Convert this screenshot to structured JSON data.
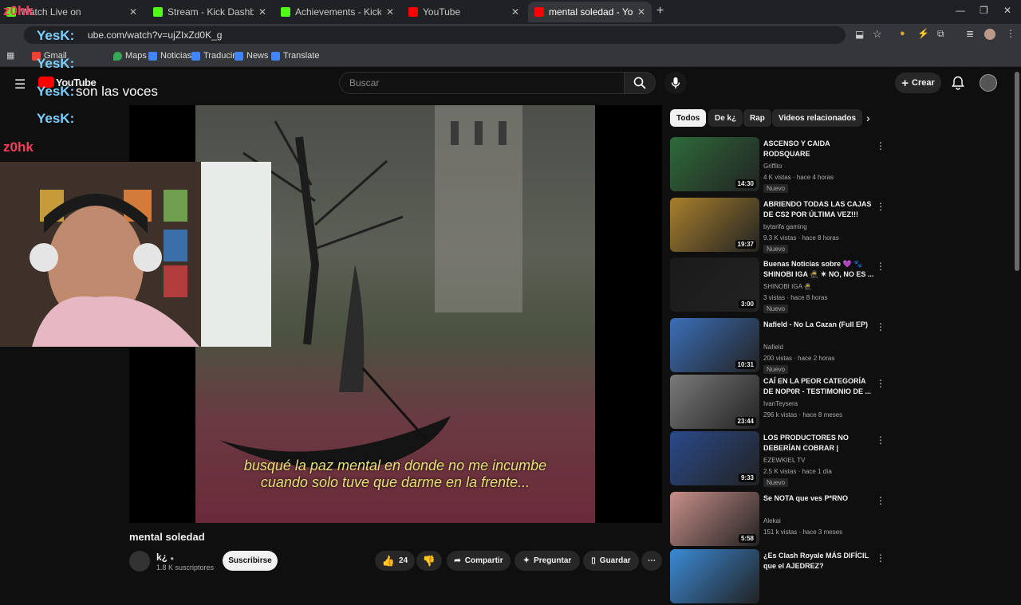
{
  "browser": {
    "tabs": [
      {
        "label": "Watch Live on",
        "icon_color": "#53fc18",
        "active": false
      },
      {
        "label": "Stream - Kick Dashboard",
        "icon_color": "#53fc18",
        "active": false
      },
      {
        "label": "Achievements - Kick Dashboard",
        "icon_color": "#53fc18",
        "active": false
      },
      {
        "label": "YouTube",
        "icon_color": "#ff0000",
        "active": false
      },
      {
        "label": "mental soledad - YouTube",
        "icon_color": "#ff0000",
        "active": true
      }
    ],
    "url": "ube.com/watch?v=ujZIxZd0K_g",
    "bookmarks": [
      "Gmail",
      "Maps",
      "Noticias",
      "Traducir",
      "News",
      "Translate"
    ]
  },
  "stream_overlay": {
    "chat": [
      {
        "user": "z0hk",
        "text": ""
      },
      {
        "user": "YesK:",
        "text": ""
      },
      {
        "user": "YesK:",
        "text": ""
      },
      {
        "user": "YesK:",
        "text": "son las voces"
      },
      {
        "user": "YesK:",
        "text": ""
      },
      {
        "user": "z0hk",
        "text": ""
      }
    ]
  },
  "youtube": {
    "logo": "YouTube",
    "search_placeholder": "Buscar",
    "create_label": "Crear",
    "colors": {
      "accent": "#ff0000",
      "background": "#0f0f0f",
      "subtitle": "#e6e076"
    }
  },
  "video": {
    "subtitle_line1": "busqué la paz mental en donde no me incumbe",
    "subtitle_line2": "cuando solo tuve que darme en la frente...",
    "title": "mental soledad",
    "channel": "k¿",
    "subscribers": "1.8 K suscriptores",
    "subscribe_label": "Suscribirse",
    "likes": "24",
    "share_label": "Compartir",
    "ask_label": "Preguntar",
    "save_label": "Guardar"
  },
  "chips": [
    "Todos",
    "De k¿",
    "Rap",
    "Videos relacionados"
  ],
  "recommendations": [
    {
      "title": "ASCENSO Y CAIDA RODSQUARE",
      "channel": "Griffito",
      "views": "4 K vistas · hace 4 horas",
      "badge": "Nuevo",
      "duration": "14:30",
      "thumb": "#2e6b3a"
    },
    {
      "title": "ABRIENDO TODAS LAS CAJAS DE CS2 POR ÚLTIMA VEZ!!!",
      "channel": "bytarifa gaming",
      "views": "9.3 K vistas · hace 8 horas",
      "badge": "Nuevo",
      "duration": "19:37",
      "thumb": "#a8802c"
    },
    {
      "title": "Buenas Noticias sobre 💜 🐾 SHINOBI IGA 🥷 ✴ NO, NO ES ...",
      "channel": "SHINOBI IGA 🥷",
      "views": "3 vistas · hace 8 horas",
      "badge": "Nuevo",
      "duration": "3:00",
      "thumb": "#1a1a1a"
    },
    {
      "title": "Nafield - No La Cazan  (Full EP)",
      "channel": "Nafield",
      "views": "200 vistas · hace 2 horas",
      "badge": "Nuevo",
      "duration": "10:31",
      "thumb": "#3b6fb8"
    },
    {
      "title": "CAÍ EN LA PEOR CATEGORÍA DE NOP0R - TESTIMONIO DE ...",
      "channel": "IvanTeysera",
      "views": "296 k vistas · hace 8 meses",
      "badge": "",
      "duration": "23:44",
      "thumb": "#7a7a7a"
    },
    {
      "title": "LOS PRODUCTORES NO DEBERÍAN COBRAR | EZEWKIEL",
      "channel": "EZEWKIEL TV",
      "views": "2.5 K vistas · hace 1 día",
      "badge": "Nuevo",
      "duration": "9:33",
      "thumb": "#2a4a8a"
    },
    {
      "title": "Se NOTA que ves P*RNO",
      "channel": "Alekai",
      "views": "151 k vistas · hace 3 meses",
      "badge": "",
      "duration": "5:58",
      "thumb": "#c98f8a"
    },
    {
      "title": "¿Es Clash Royale MÁS DIFÍCIL que el AJEDREZ?",
      "channel": "",
      "views": "",
      "badge": "",
      "duration": "",
      "thumb": "#3a8ad6"
    }
  ]
}
